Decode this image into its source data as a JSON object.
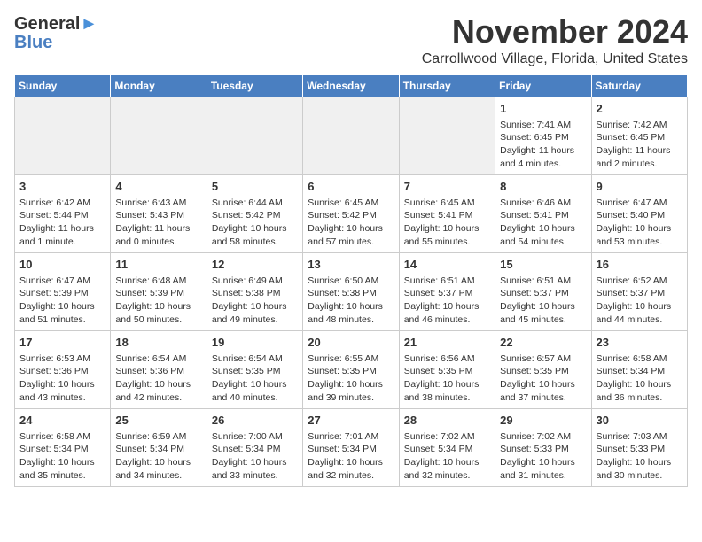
{
  "header": {
    "logo_line1": "General",
    "logo_line2": "Blue",
    "month_year": "November 2024",
    "location": "Carrollwood Village, Florida, United States"
  },
  "weekdays": [
    "Sunday",
    "Monday",
    "Tuesday",
    "Wednesday",
    "Thursday",
    "Friday",
    "Saturday"
  ],
  "weeks": [
    [
      {
        "day": "",
        "empty": true
      },
      {
        "day": "",
        "empty": true
      },
      {
        "day": "",
        "empty": true
      },
      {
        "day": "",
        "empty": true
      },
      {
        "day": "",
        "empty": true
      },
      {
        "day": "1",
        "sunrise": "7:41 AM",
        "sunset": "6:45 PM",
        "daylight": "11 hours and 4 minutes."
      },
      {
        "day": "2",
        "sunrise": "7:42 AM",
        "sunset": "6:45 PM",
        "daylight": "11 hours and 2 minutes."
      }
    ],
    [
      {
        "day": "3",
        "sunrise": "6:42 AM",
        "sunset": "5:44 PM",
        "daylight": "11 hours and 1 minute."
      },
      {
        "day": "4",
        "sunrise": "6:43 AM",
        "sunset": "5:43 PM",
        "daylight": "11 hours and 0 minutes."
      },
      {
        "day": "5",
        "sunrise": "6:44 AM",
        "sunset": "5:42 PM",
        "daylight": "10 hours and 58 minutes."
      },
      {
        "day": "6",
        "sunrise": "6:45 AM",
        "sunset": "5:42 PM",
        "daylight": "10 hours and 57 minutes."
      },
      {
        "day": "7",
        "sunrise": "6:45 AM",
        "sunset": "5:41 PM",
        "daylight": "10 hours and 55 minutes."
      },
      {
        "day": "8",
        "sunrise": "6:46 AM",
        "sunset": "5:41 PM",
        "daylight": "10 hours and 54 minutes."
      },
      {
        "day": "9",
        "sunrise": "6:47 AM",
        "sunset": "5:40 PM",
        "daylight": "10 hours and 53 minutes."
      }
    ],
    [
      {
        "day": "10",
        "sunrise": "6:47 AM",
        "sunset": "5:39 PM",
        "daylight": "10 hours and 51 minutes."
      },
      {
        "day": "11",
        "sunrise": "6:48 AM",
        "sunset": "5:39 PM",
        "daylight": "10 hours and 50 minutes."
      },
      {
        "day": "12",
        "sunrise": "6:49 AM",
        "sunset": "5:38 PM",
        "daylight": "10 hours and 49 minutes."
      },
      {
        "day": "13",
        "sunrise": "6:50 AM",
        "sunset": "5:38 PM",
        "daylight": "10 hours and 48 minutes."
      },
      {
        "day": "14",
        "sunrise": "6:51 AM",
        "sunset": "5:37 PM",
        "daylight": "10 hours and 46 minutes."
      },
      {
        "day": "15",
        "sunrise": "6:51 AM",
        "sunset": "5:37 PM",
        "daylight": "10 hours and 45 minutes."
      },
      {
        "day": "16",
        "sunrise": "6:52 AM",
        "sunset": "5:37 PM",
        "daylight": "10 hours and 44 minutes."
      }
    ],
    [
      {
        "day": "17",
        "sunrise": "6:53 AM",
        "sunset": "5:36 PM",
        "daylight": "10 hours and 43 minutes."
      },
      {
        "day": "18",
        "sunrise": "6:54 AM",
        "sunset": "5:36 PM",
        "daylight": "10 hours and 42 minutes."
      },
      {
        "day": "19",
        "sunrise": "6:54 AM",
        "sunset": "5:35 PM",
        "daylight": "10 hours and 40 minutes."
      },
      {
        "day": "20",
        "sunrise": "6:55 AM",
        "sunset": "5:35 PM",
        "daylight": "10 hours and 39 minutes."
      },
      {
        "day": "21",
        "sunrise": "6:56 AM",
        "sunset": "5:35 PM",
        "daylight": "10 hours and 38 minutes."
      },
      {
        "day": "22",
        "sunrise": "6:57 AM",
        "sunset": "5:35 PM",
        "daylight": "10 hours and 37 minutes."
      },
      {
        "day": "23",
        "sunrise": "6:58 AM",
        "sunset": "5:34 PM",
        "daylight": "10 hours and 36 minutes."
      }
    ],
    [
      {
        "day": "24",
        "sunrise": "6:58 AM",
        "sunset": "5:34 PM",
        "daylight": "10 hours and 35 minutes."
      },
      {
        "day": "25",
        "sunrise": "6:59 AM",
        "sunset": "5:34 PM",
        "daylight": "10 hours and 34 minutes."
      },
      {
        "day": "26",
        "sunrise": "7:00 AM",
        "sunset": "5:34 PM",
        "daylight": "10 hours and 33 minutes."
      },
      {
        "day": "27",
        "sunrise": "7:01 AM",
        "sunset": "5:34 PM",
        "daylight": "10 hours and 32 minutes."
      },
      {
        "day": "28",
        "sunrise": "7:02 AM",
        "sunset": "5:34 PM",
        "daylight": "10 hours and 32 minutes."
      },
      {
        "day": "29",
        "sunrise": "7:02 AM",
        "sunset": "5:33 PM",
        "daylight": "10 hours and 31 minutes."
      },
      {
        "day": "30",
        "sunrise": "7:03 AM",
        "sunset": "5:33 PM",
        "daylight": "10 hours and 30 minutes."
      }
    ]
  ],
  "labels": {
    "sunrise_prefix": "Sunrise: ",
    "sunset_prefix": "Sunset: ",
    "daylight_prefix": "Daylight: "
  }
}
